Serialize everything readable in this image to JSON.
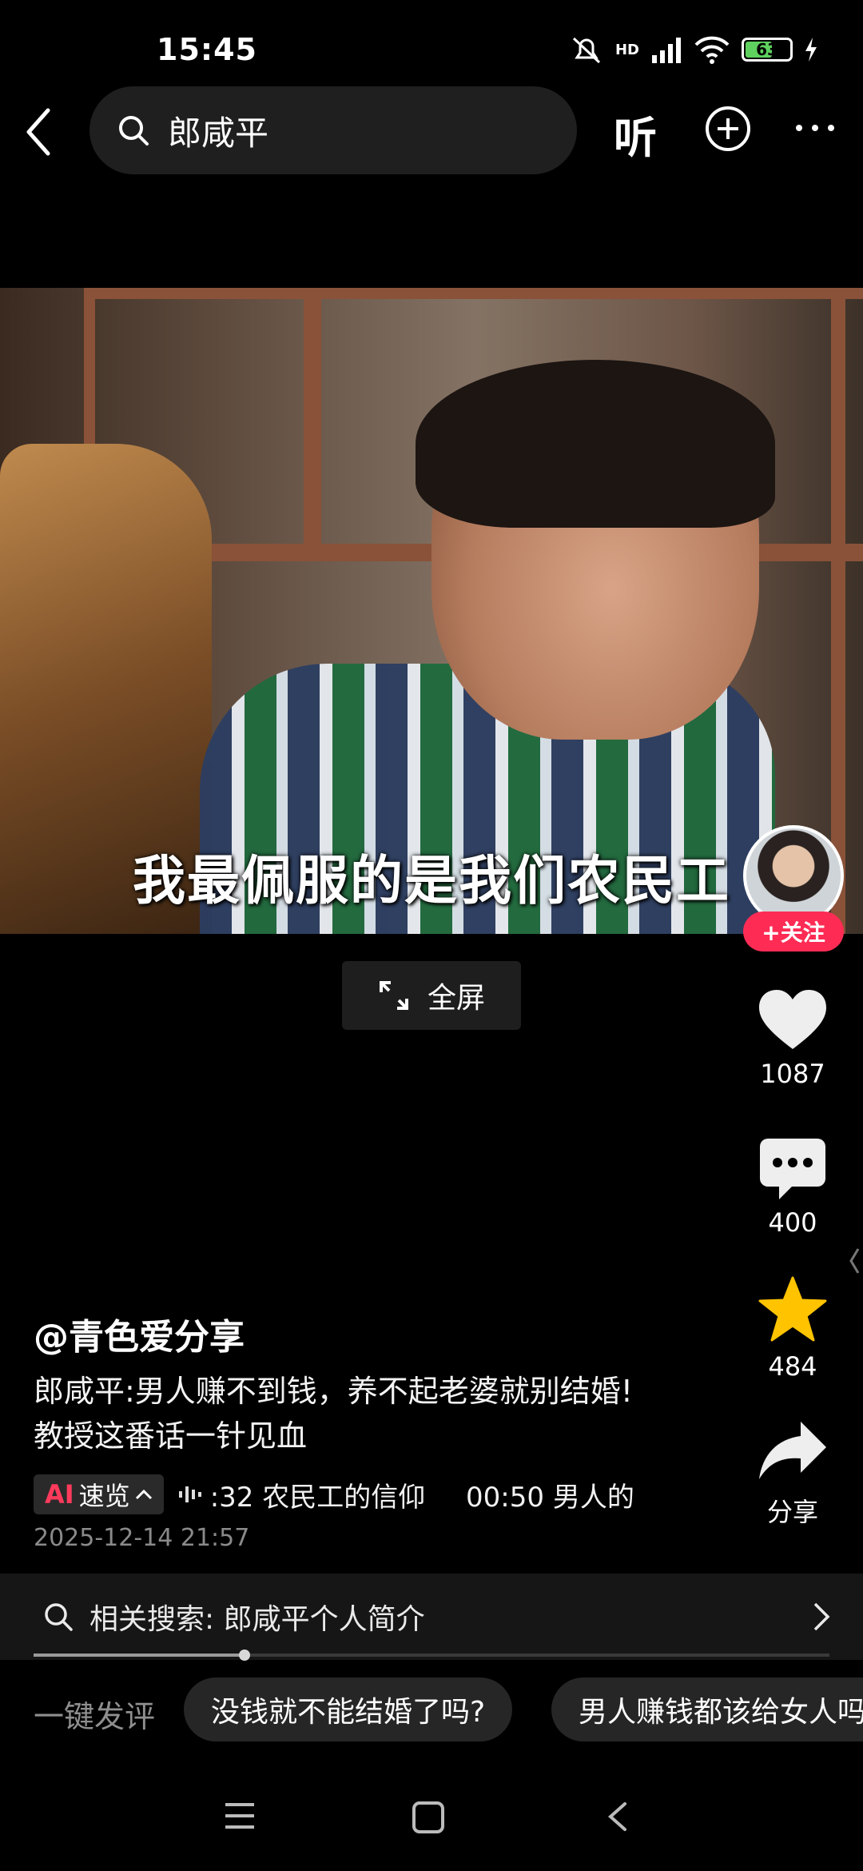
{
  "status_bar": {
    "time": "15:45",
    "network": "HD",
    "battery": "63",
    "battery_level_percent": 63
  },
  "header": {
    "search_query": "郎咸平",
    "listen_label": "听"
  },
  "video": {
    "subtitle": "我最佩服的是我们农民工",
    "follow_label": "+关注",
    "fullscreen_label": "全屏"
  },
  "actions": {
    "likes": "1087",
    "comments": "400",
    "favorites": "484",
    "share_label": "分享"
  },
  "post": {
    "author": "@青色爱分享",
    "description_line1": "郎咸平:男人赚不到钱，养不起老婆就别结婚!",
    "description_line2": "教授这番话一针见血",
    "ai_label_ai": "AI",
    "ai_label_text": "速览",
    "chapters": [
      ":32 农民工的信仰",
      "00:50 男人的"
    ],
    "date": "2025-12-14 21:57"
  },
  "related_search": {
    "text": "相关搜索: 郎咸平个人简介"
  },
  "playback": {
    "progress_fraction": 0.265
  },
  "quick_comment": {
    "label": "一键发评",
    "suggestions": [
      "没钱就不能结婚了吗?",
      "男人赚钱都该给女人吗"
    ]
  },
  "colors": {
    "accent_red": "#fe2c55",
    "favorite_yellow": "#ffc300",
    "background": "#000000"
  }
}
